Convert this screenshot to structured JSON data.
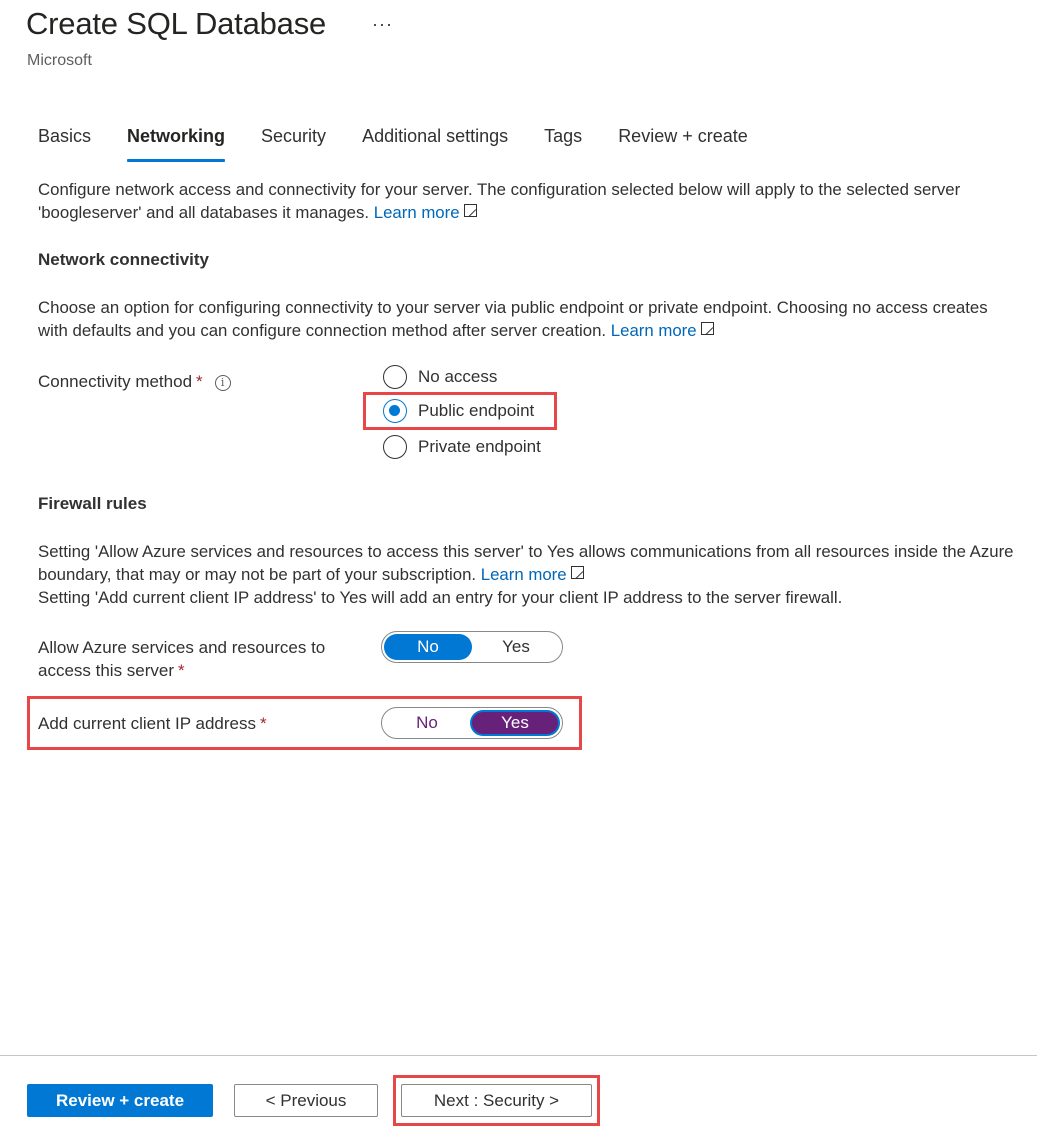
{
  "header": {
    "title": "Create SQL Database",
    "more_icon": "ellipsis-icon",
    "subtitle": "Microsoft"
  },
  "tabs": [
    {
      "label": "Basics",
      "active": false
    },
    {
      "label": "Networking",
      "active": true
    },
    {
      "label": "Security",
      "active": false
    },
    {
      "label": "Additional settings",
      "active": false
    },
    {
      "label": "Tags",
      "active": false
    },
    {
      "label": "Review + create",
      "active": false
    }
  ],
  "intro": {
    "text": "Configure network access and connectivity for your server. The configuration selected below will apply to the selected server 'boogleserver' and all databases it manages.",
    "link": "Learn more",
    "link_icon": "external-link-icon"
  },
  "network_connectivity": {
    "heading": "Network connectivity",
    "description": "Choose an option for configuring connectivity to your server via public endpoint or private endpoint. Choosing no access creates with defaults and you can configure connection method after server creation.",
    "link": "Learn more",
    "field_label": "Connectivity method",
    "required_mark": "*",
    "info_icon": "info-icon",
    "info_glyph": "i",
    "options": [
      {
        "label": "No access",
        "checked": false
      },
      {
        "label": "Public endpoint",
        "checked": true
      },
      {
        "label": "Private endpoint",
        "checked": false
      }
    ]
  },
  "firewall": {
    "heading": "Firewall rules",
    "description_1": "Setting 'Allow Azure services and resources to access this server' to Yes allows communications from all resources inside the Azure boundary, that may or may not be part of your subscription.",
    "link": "Learn more",
    "description_2": "Setting 'Add current client IP address' to Yes will add an entry for your client IP address to the server firewall.",
    "allow_azure": {
      "label_line1": "Allow Azure services and resources to",
      "label_line2": "access this server",
      "required_mark": "*",
      "options": [
        "No",
        "Yes"
      ],
      "selected": "No"
    },
    "client_ip": {
      "label": "Add current client IP address",
      "required_mark": "*",
      "options": [
        "No",
        "Yes"
      ],
      "selected": "Yes"
    }
  },
  "footer": {
    "review_create": "Review + create",
    "previous": "< Previous",
    "next": "Next : Security >"
  },
  "colors": {
    "accent": "#0078d4",
    "link": "#0067b8",
    "required": "#a4262c",
    "highlight_border": "#e8474a",
    "toggle_selected_purple": "#68217a"
  }
}
